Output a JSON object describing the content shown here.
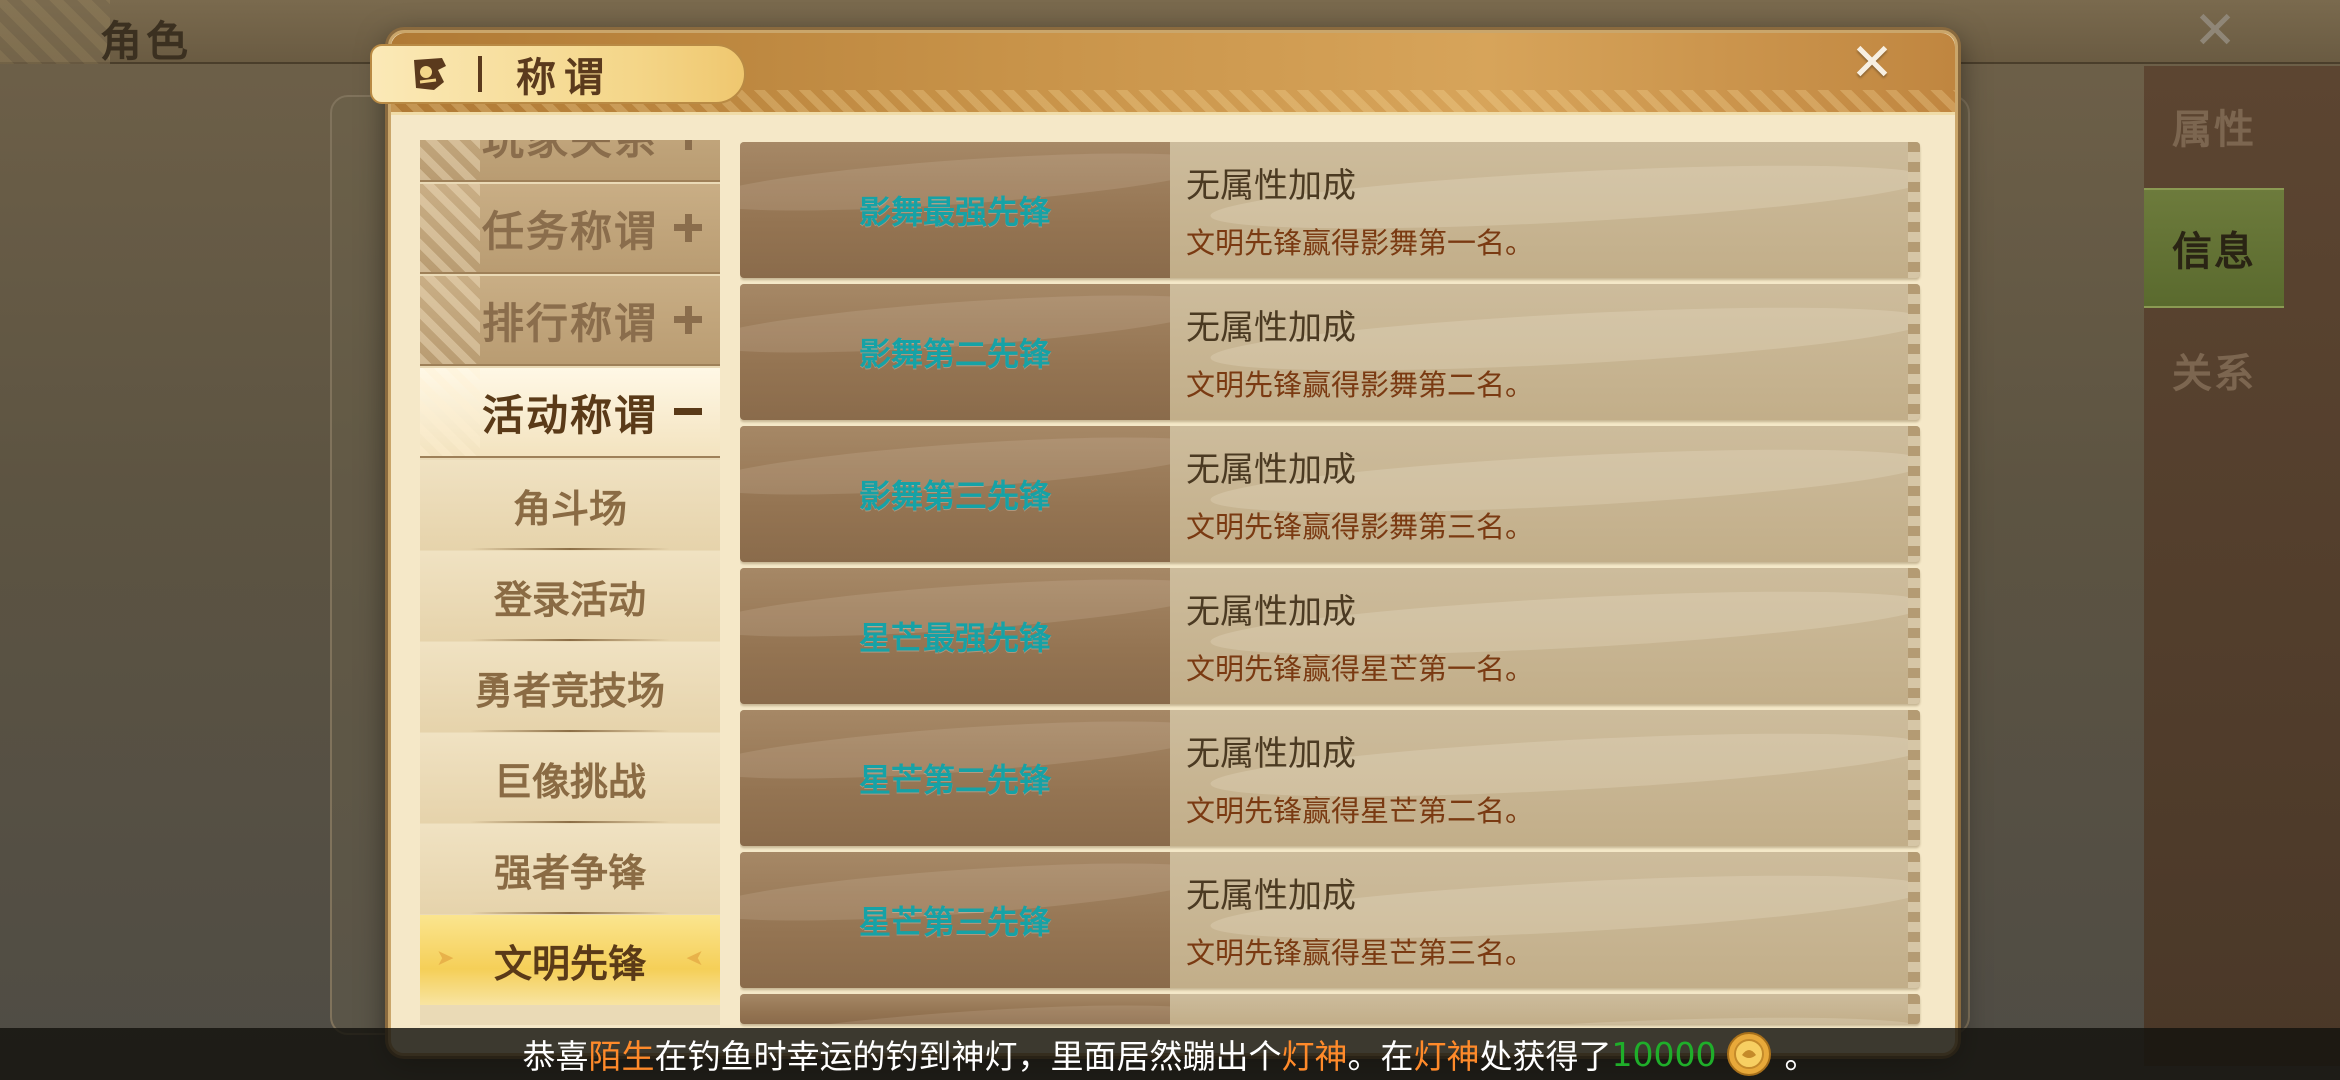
{
  "background": {
    "window_title": "角色",
    "side_tabs": [
      {
        "label": "属性",
        "active": false
      },
      {
        "label": "信息",
        "active": true
      },
      {
        "label": "关系",
        "active": false
      }
    ]
  },
  "dialog": {
    "title": "称谓",
    "categories": [
      {
        "label": "玩家关系",
        "state": "collapsed"
      },
      {
        "label": "任务称谓",
        "state": "collapsed"
      },
      {
        "label": "排行称谓",
        "state": "collapsed"
      },
      {
        "label": "活动称谓",
        "state": "expanded"
      }
    ],
    "subcategories": [
      {
        "label": "角斗场",
        "selected": false
      },
      {
        "label": "登录活动",
        "selected": false
      },
      {
        "label": "勇者竞技场",
        "selected": false
      },
      {
        "label": "巨像挑战",
        "selected": false
      },
      {
        "label": "强者争锋",
        "selected": false
      },
      {
        "label": "文明先锋",
        "selected": true
      }
    ],
    "titles": [
      {
        "name": "影舞最强先锋",
        "bonus": "无属性加成",
        "desc": "文明先锋赢得影舞第一名。"
      },
      {
        "name": "影舞第二先锋",
        "bonus": "无属性加成",
        "desc": "文明先锋赢得影舞第二名。"
      },
      {
        "name": "影舞第三先锋",
        "bonus": "无属性加成",
        "desc": "文明先锋赢得影舞第三名。"
      },
      {
        "name": "星芒最强先锋",
        "bonus": "无属性加成",
        "desc": "文明先锋赢得星芒第一名。"
      },
      {
        "name": "星芒第二先锋",
        "bonus": "无属性加成",
        "desc": "文明先锋赢得星芒第二名。"
      },
      {
        "name": "星芒第三先锋",
        "bonus": "无属性加成",
        "desc": "文明先锋赢得星芒第三名。"
      }
    ]
  },
  "broadcast": {
    "prefix": "恭喜",
    "player": "陌生",
    "text1": "在钓鱼时幸运的钓到神灯，里面居然蹦出个",
    "npc1": "灯神",
    "text2": "。在",
    "npc2": "灯神",
    "text3": "处获得了",
    "amount": "10000",
    "suffix": "。",
    "colors": {
      "highlight": "#ff8a2a",
      "amount": "#1fae2a"
    }
  }
}
